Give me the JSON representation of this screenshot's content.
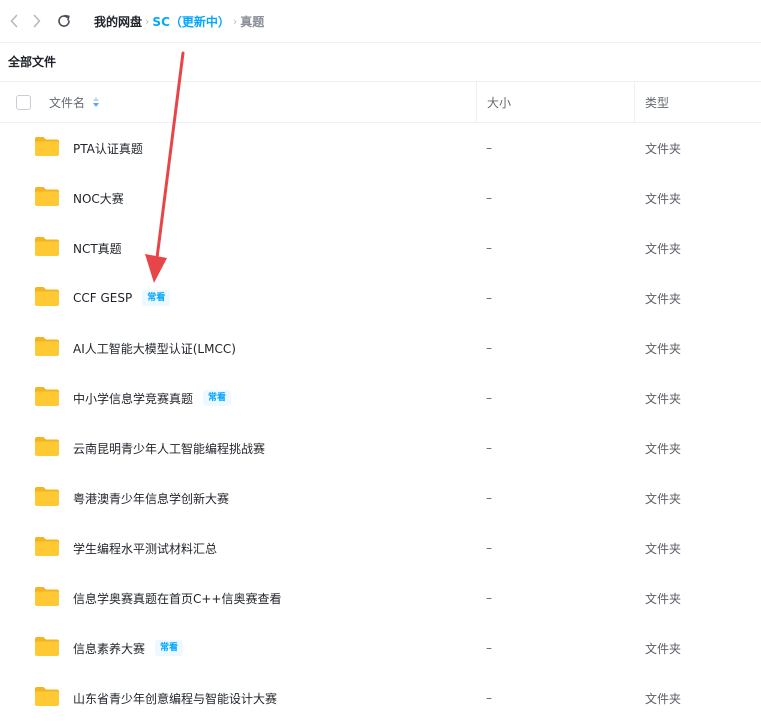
{
  "breadcrumb": {
    "root": "我的网盘",
    "folder": "SC（更新中）",
    "current": "真题",
    "separator": "›"
  },
  "section_title": "全部文件",
  "columns": {
    "name": "文件名",
    "size": "大小",
    "type": "类型"
  },
  "rows": [
    {
      "name": "PTA认证真题",
      "size": "–",
      "type": "文件夹"
    },
    {
      "name": "NOC大赛",
      "size": "–",
      "type": "文件夹"
    },
    {
      "name": "NCT真题",
      "size": "–",
      "type": "文件夹"
    },
    {
      "name": "CCF GESP",
      "badge": "常看",
      "size": "–",
      "type": "文件夹"
    },
    {
      "name": "AI人工智能大模型认证(LMCC)",
      "size": "–",
      "type": "文件夹"
    },
    {
      "name": "中小学信息学竞赛真题",
      "badge": "常看",
      "size": "–",
      "type": "文件夹"
    },
    {
      "name": "云南昆明青少年人工智能编程挑战赛",
      "size": "–",
      "type": "文件夹"
    },
    {
      "name": "粤港澳青少年信息学创新大赛",
      "size": "–",
      "type": "文件夹"
    },
    {
      "name": "学生编程水平测试材料汇总",
      "size": "–",
      "type": "文件夹"
    },
    {
      "name": "信息学奥赛真题在首页C++信奥赛查看",
      "size": "–",
      "type": "文件夹"
    },
    {
      "name": "信息素养大赛",
      "badge": "常看",
      "size": "–",
      "type": "文件夹"
    },
    {
      "name": "山东省青少年创意编程与智能设计大赛",
      "size": "–",
      "type": "文件夹"
    }
  ],
  "icons": {
    "back": "chevron-left-icon",
    "forward": "chevron-right-icon",
    "refresh": "refresh-icon",
    "sort": "sort-icon",
    "folder": "folder-icon"
  },
  "colors": {
    "accent": "#06a7ff",
    "folder": "#ffc933",
    "annotation_arrow": "#e8454a"
  }
}
